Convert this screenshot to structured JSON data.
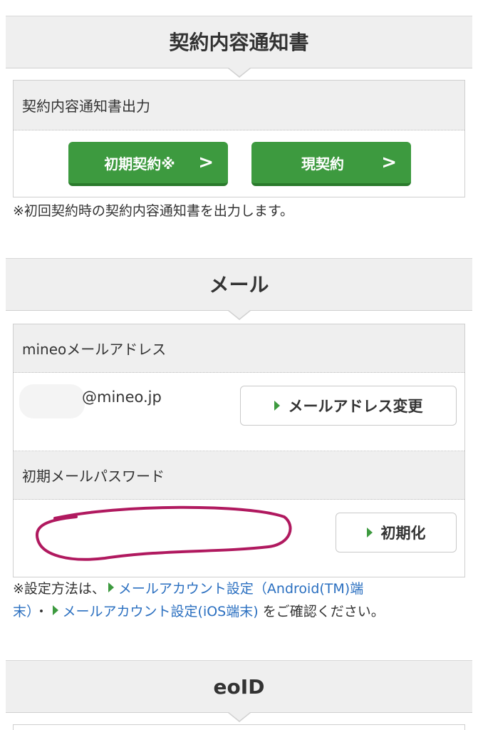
{
  "contract": {
    "section_title": "契約内容通知書",
    "box_label": "契約内容通知書出力",
    "btn_initial": "初期契約※",
    "btn_current": "現契約",
    "note": "※初回契約時の契約内容通知書を出力します。"
  },
  "mail": {
    "section_title": "メール",
    "address_label": "mineoメールアドレス",
    "address_value": "@mineo.jp",
    "change_button": "メールアドレス変更",
    "password_label": "初期メールパスワード",
    "reset_button": "初期化",
    "note_prefix": "※設定方法は、",
    "link_android_1": "メールアカウント設定（Android(TM)端",
    "link_android_2": "末）",
    "separator": "・",
    "link_ios": "メールアカウント設定(iOS端末)",
    "note_suffix": " をご確認ください。"
  },
  "eoid": {
    "section_title": "eoID"
  },
  "colors": {
    "button_green": "#3d9a3f",
    "link_blue": "#2a6fc0",
    "redaction_marker": "#b0195f"
  }
}
